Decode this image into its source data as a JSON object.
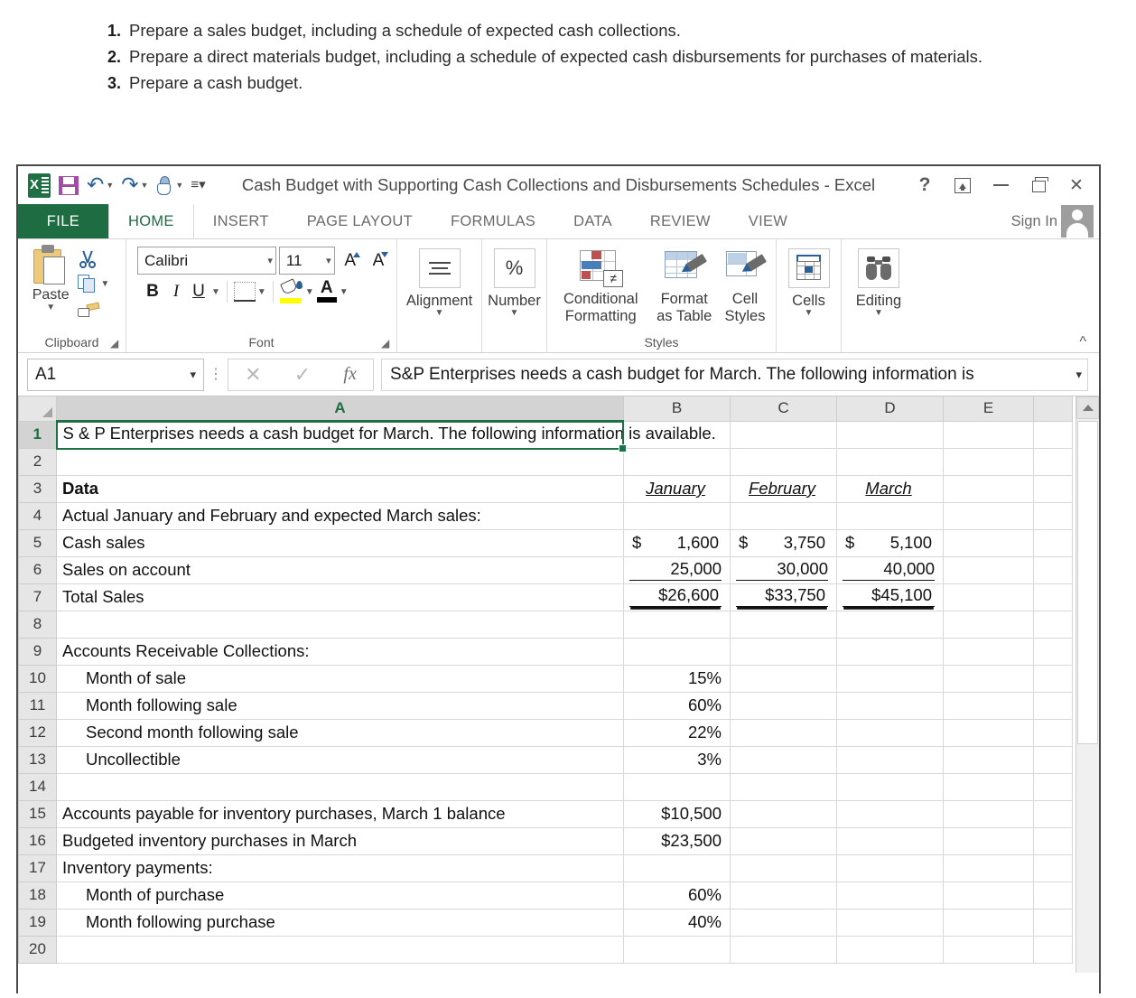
{
  "instructions": [
    {
      "num": "1.",
      "text": "Prepare a sales budget, including a schedule of expected cash collections."
    },
    {
      "num": "2.",
      "text": "Prepare a direct materials budget, including a schedule of expected cash disbursements for purchases of materials."
    },
    {
      "num": "3.",
      "text": "Prepare a cash budget."
    }
  ],
  "window": {
    "title": "Cash Budget with Supporting Cash Collections and Disbursements Schedules - Excel",
    "quick_access": [
      "excel-logo",
      "save-icon",
      "undo-icon",
      "redo-icon",
      "touch-mode-icon",
      "customize-qat-icon"
    ],
    "buttons": {
      "help": "?",
      "ribbon_display_options": "ribbon-display-options-icon",
      "minimize": "minimize-icon",
      "restore": "restore-icon",
      "close": "✕"
    }
  },
  "ribbon": {
    "tabs": [
      {
        "label": "FILE",
        "active": false,
        "is_file": true
      },
      {
        "label": "HOME",
        "active": true
      },
      {
        "label": "INSERT",
        "active": false
      },
      {
        "label": "PAGE LAYOUT",
        "active": false
      },
      {
        "label": "FORMULAS",
        "active": false
      },
      {
        "label": "DATA",
        "active": false
      },
      {
        "label": "REVIEW",
        "active": false
      },
      {
        "label": "VIEW",
        "active": false
      }
    ],
    "sign_in": "Sign In",
    "groups": {
      "clipboard": {
        "label": "Clipboard",
        "paste": "Paste",
        "items": [
          "cut-icon",
          "copy-icon",
          "format-painter-icon"
        ]
      },
      "font": {
        "label": "Font",
        "font_name": "Calibri",
        "font_size": "11",
        "bold": "B",
        "italic": "I",
        "underline": "U",
        "grow_font": "A",
        "shrink_font": "A"
      },
      "alignment": {
        "label": "Alignment"
      },
      "number": {
        "label": "Number",
        "symbol": "%"
      },
      "styles": {
        "label": "Styles",
        "conditional_formatting": "Conditional Formatting",
        "format_as_table": "Format as Table",
        "cell_styles": "Cell Styles",
        "neq_symbol": "≠"
      },
      "cells": {
        "label": "Cells"
      },
      "editing": {
        "label": "Editing"
      }
    }
  },
  "formula_bar": {
    "name_box": "A1",
    "cancel": "✕",
    "enter": "✓",
    "insert_function": "fx",
    "content": "S&P Enterprises needs a cash budget for March. The following information is"
  },
  "sheet": {
    "columns": [
      "A",
      "B",
      "C",
      "D",
      "E"
    ],
    "active_column": "A",
    "active_row": 1,
    "rows": [
      {
        "n": 1,
        "a": "S & P Enterprises needs a cash budget for March. The following information is available.",
        "b": "",
        "c": "",
        "d": "",
        "style": "spill"
      },
      {
        "n": 2,
        "a": "",
        "b": "",
        "c": "",
        "d": ""
      },
      {
        "n": 3,
        "a": "Data",
        "b": "January",
        "c": "February",
        "d": "March",
        "style": "header",
        "a_bold": true
      },
      {
        "n": 4,
        "a": "Actual January and February and expected March sales:",
        "b": "",
        "c": "",
        "d": ""
      },
      {
        "n": 5,
        "a": "Cash sales",
        "b": "1,600",
        "c": "3,750",
        "d": "5,100",
        "style": "money"
      },
      {
        "n": 6,
        "a": "Sales on account",
        "b": "25,000",
        "c": "30,000",
        "d": "40,000",
        "style": "underline"
      },
      {
        "n": 7,
        "a": "Total Sales",
        "b": "26,600",
        "c": "33,750",
        "d": "45,100",
        "style": "total"
      },
      {
        "n": 8,
        "a": "",
        "b": "",
        "c": "",
        "d": ""
      },
      {
        "n": 9,
        "a": "Accounts Receivable Collections:",
        "b": "",
        "c": "",
        "d": ""
      },
      {
        "n": 10,
        "a": "Month of sale",
        "b": "15%",
        "c": "",
        "d": "",
        "indent": true
      },
      {
        "n": 11,
        "a": "Month following sale",
        "b": "60%",
        "c": "",
        "d": "",
        "indent": true
      },
      {
        "n": 12,
        "a": "Second month following sale",
        "b": "22%",
        "c": "",
        "d": "",
        "indent": true
      },
      {
        "n": 13,
        "a": "Uncollectible",
        "b": "3%",
        "c": "",
        "d": "",
        "indent": true
      },
      {
        "n": 14,
        "a": "",
        "b": "",
        "c": "",
        "d": ""
      },
      {
        "n": 15,
        "a": "Accounts payable for inventory purchases, March 1 balance",
        "b": "$10,500",
        "c": "",
        "d": ""
      },
      {
        "n": 16,
        "a": "Budgeted inventory purchases in March",
        "b": "$23,500",
        "c": "",
        "d": ""
      },
      {
        "n": 17,
        "a": "Inventory payments:",
        "b": "",
        "c": "",
        "d": ""
      },
      {
        "n": 18,
        "a": "Month of purchase",
        "b": "60%",
        "c": "",
        "d": "",
        "indent": true
      },
      {
        "n": 19,
        "a": "Month following purchase",
        "b": "40%",
        "c": "",
        "d": "",
        "indent": true
      },
      {
        "n": 20,
        "a": "",
        "b": "",
        "c": "",
        "d": ""
      }
    ],
    "currency_symbol": "$"
  },
  "colors": {
    "excel_green": "#1e6c41",
    "selection_green": "#1e7145",
    "header_gray": "#e6e6e6",
    "grid_line": "#d8d8d8"
  }
}
